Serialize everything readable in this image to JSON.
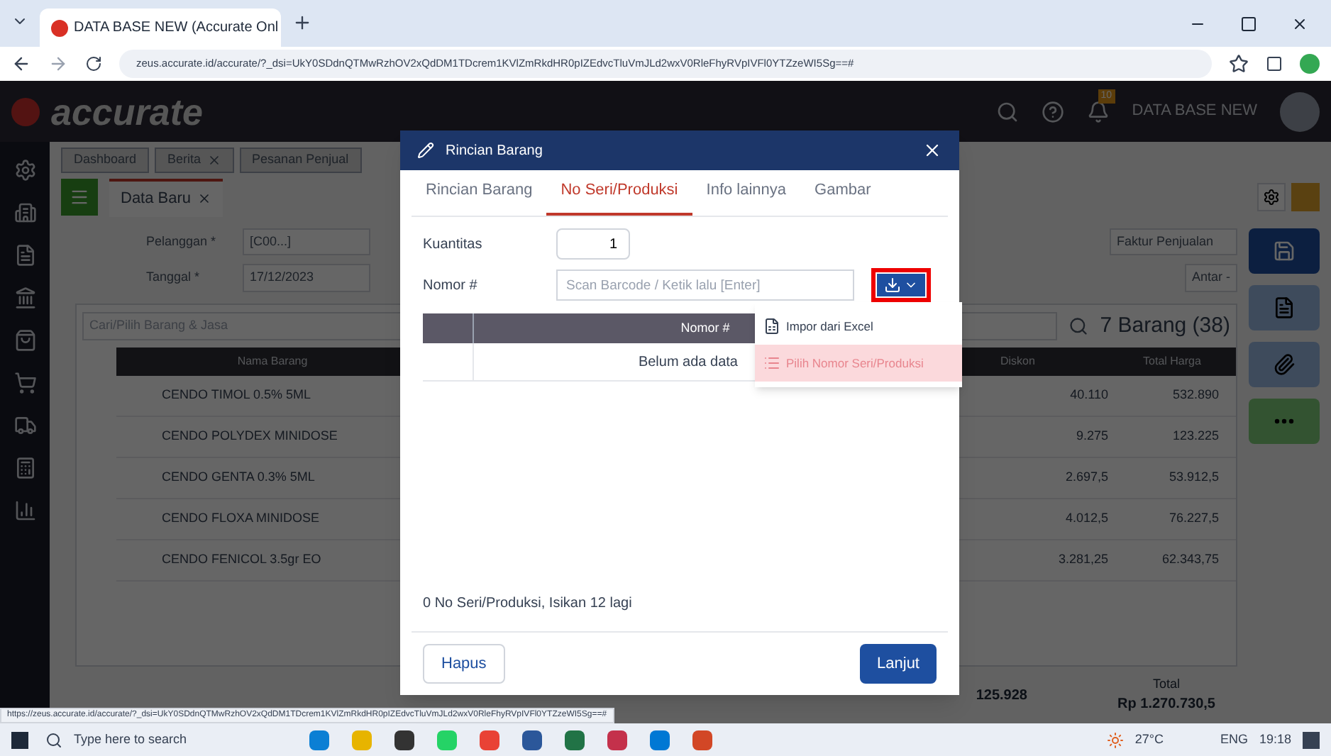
{
  "browser": {
    "tab_title": "DATA BASE NEW (Accurate Onl",
    "url": "zeus.accurate.id/accurate/?_dsi=UkY0SDdnQTMwRzhOV2xQdDM1TDcrem1KVlZmRkdHR0pIZEdvcTluVmJLd2wxV0RleFhyRVpIVFl0YTZzeWI5Sg==#"
  },
  "app": {
    "logo": "accurate",
    "database": "DATA BASE NEW",
    "notification_count": "10",
    "tabs": [
      {
        "label": "Dashboard",
        "closable": false
      },
      {
        "label": "Berita",
        "closable": true
      },
      {
        "label": "Pesanan Penjual",
        "closable": false
      }
    ],
    "form_tab": "Data Baru",
    "fields": [
      {
        "label": "Pelanggan *",
        "value": "[C00...]"
      },
      {
        "label": "Tanggal *",
        "value": "17/12/2023"
      }
    ],
    "doc_type": "Faktur Penjualan",
    "deliver_button": "Antar -",
    "search_placeholder": "Cari/Pilih Barang & Jasa",
    "item_count": "7 Barang (38)",
    "columns": [
      "Nama Barang",
      "Diskon",
      "Total Harga"
    ],
    "rows": [
      {
        "name": "CENDO TIMOL 0.5% 5ML",
        "discount": "40.110",
        "total": "532.890"
      },
      {
        "name": "CENDO POLYDEX MINIDOSE",
        "discount": "9.275",
        "total": "123.225"
      },
      {
        "name": "CENDO GENTA 0.3% 5ML",
        "discount": "2.697,5",
        "total": "53.912,5"
      },
      {
        "name": "CENDO FLOXA MINIDOSE",
        "discount": "4.012,5",
        "total": "76.227,5"
      },
      {
        "name": "CENDO FENICOL 3.5gr EO",
        "discount": "3.281,25",
        "total": "62.343,75"
      }
    ],
    "subtotal": "125.928",
    "total_label": "Total",
    "total": "Rp 1.270.730,5"
  },
  "dialog": {
    "title": "Rincian Barang",
    "tabs": [
      {
        "label": "Rincian Barang",
        "selected": false
      },
      {
        "label": "No Seri/Produksi",
        "selected": true
      },
      {
        "label": "Info lainnya",
        "selected": false
      },
      {
        "label": "Gambar",
        "selected": false
      }
    ],
    "quantity_label": "Kuantitas",
    "quantity": "1",
    "number_label": "Nomor #",
    "number_placeholder": "Scan Barcode / Ketik lalu [Enter]",
    "menu": [
      {
        "label": "Impor dari Excel",
        "selected": false
      },
      {
        "label": "Pilih Nomor Seri/Produksi",
        "selected": true
      }
    ],
    "table_column": "Nomor #",
    "empty_text": "Belum ada data",
    "footer_text": "0 No Seri/Produksi, Isikan 12 lagi",
    "buttons": [
      {
        "label": "Hapus",
        "kind": "secondary"
      },
      {
        "label": "Lanjut",
        "kind": "primary"
      }
    ]
  },
  "status_url": "https://zeus.accurate.id/accurate/?_dsi=UkY0SDdnQTMwRzhOV2xQdDM1TDcrem1KVlZmRkdHR0pIZEdvcTluVmJLd2wxV0RleFhyRVpIVFl0YTZzeWI5Sg==#",
  "taskbar": {
    "search_placeholder": "Type here to search",
    "temperature": "27°C",
    "language": "ENG",
    "time": "19:18"
  }
}
